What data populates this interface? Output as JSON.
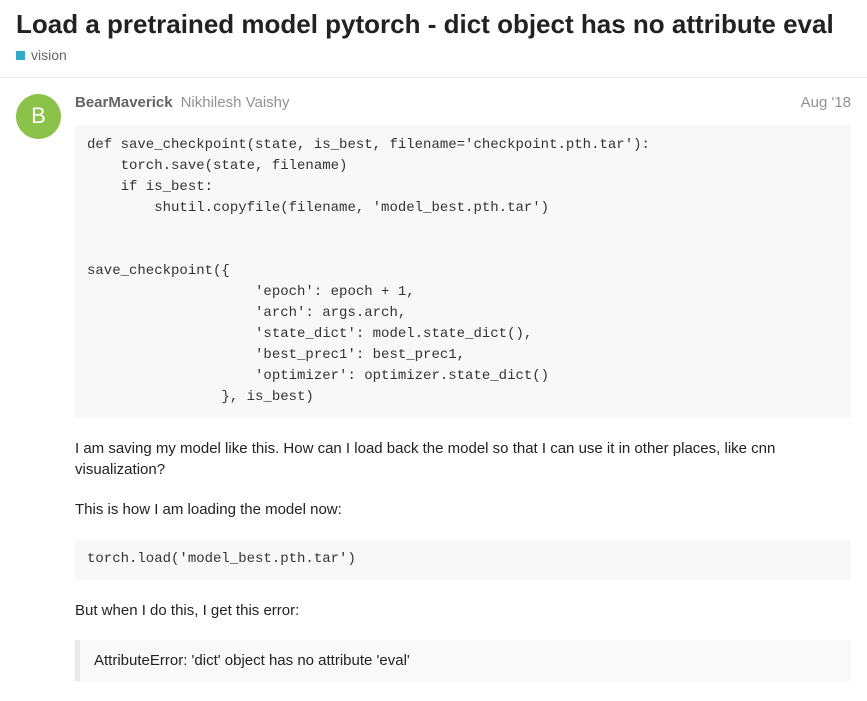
{
  "header": {
    "title": "Load a pretrained model pytorch - dict object has no attribute eval",
    "category": "vision"
  },
  "post": {
    "avatar_initial": "B",
    "username": "BearMaverick",
    "fullname": "Nikhilesh Vaishy",
    "date": "Aug '18",
    "code1": "def save_checkpoint(state, is_best, filename='checkpoint.pth.tar'):\n    torch.save(state, filename)\n    if is_best:\n        shutil.copyfile(filename, 'model_best.pth.tar')\n\n\nsave_checkpoint({\n                    'epoch': epoch + 1,\n                    'arch': args.arch,\n                    'state_dict': model.state_dict(),\n                    'best_prec1': best_prec1,\n                    'optimizer': optimizer.state_dict()\n                }, is_best)",
    "para1": "I am saving my model like this. How can I load back the model so that I can use it in other places, like cnn visualization?",
    "para2": "This is how I am loading the model now:",
    "code2": "torch.load('model_best.pth.tar')",
    "para3": "But when I do this, I get this error:",
    "quote": "AttributeError: 'dict' object has no attribute 'eval'"
  }
}
